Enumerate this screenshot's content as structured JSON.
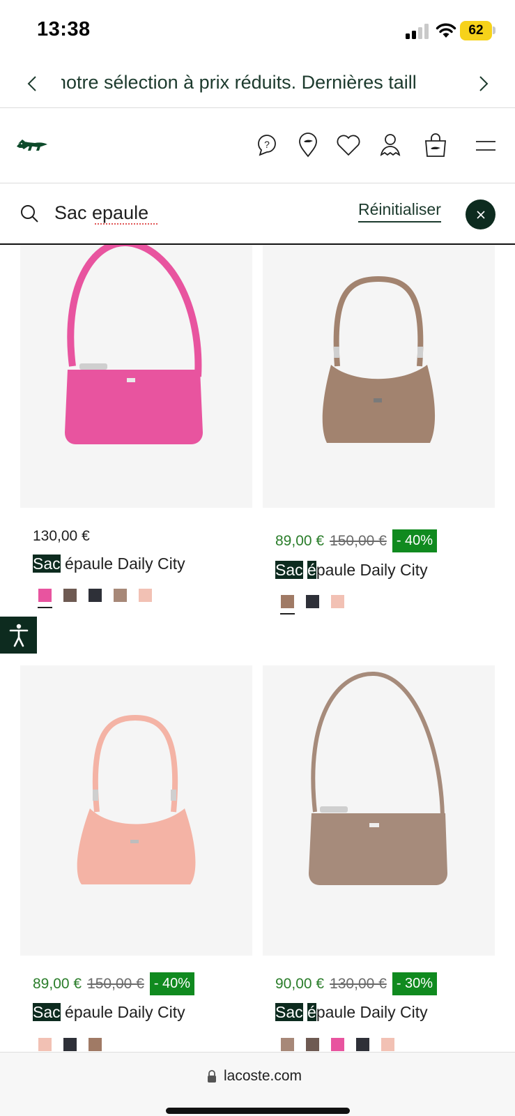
{
  "status_bar": {
    "time": "13:38",
    "battery": "62"
  },
  "promo": {
    "text": "notre sélection à prix réduits. Dernières taill"
  },
  "header": {
    "wishlist_count": "0",
    "cart_count": "0"
  },
  "search": {
    "query": "Sac epaule",
    "reset_label": "Réinitialiser"
  },
  "products": [
    {
      "price": "130,00 €",
      "title_highlight": "Sac",
      "title_rest": " épaule Daily City",
      "bag_color": "#e8549f",
      "swatches": [
        "#e8549f",
        "#6e5a52",
        "#2e3038",
        "#a78878",
        "#f2c1b4"
      ]
    },
    {
      "price": "89,00 €",
      "old_price": "150,00 €",
      "discount": "- 40%",
      "title_highlight": "Sac",
      "title_mid_highlight": "é",
      "title_rest": "paule Daily City",
      "bag_color": "#a2836f",
      "swatches": [
        "#a07a65",
        "#2e3038",
        "#f2c1b4"
      ]
    },
    {
      "price": "89,00 €",
      "old_price": "150,00 €",
      "discount": "- 40%",
      "title_highlight": "Sac",
      "title_rest": " épaule Daily City",
      "bag_color": "#f4b3a5",
      "swatches": [
        "#f2c1b4",
        "#2e3038",
        "#a07a65"
      ]
    },
    {
      "price": "90,00 €",
      "old_price": "130,00 €",
      "discount": "- 30%",
      "title_highlight": "Sac",
      "title_mid_highlight": "é",
      "title_rest": "paule Daily City",
      "bag_color": "#a68b7b",
      "swatches": [
        "#a78878",
        "#6e5a52",
        "#e8549f",
        "#2e3038",
        "#f2c1b4"
      ]
    }
  ],
  "url_bar": {
    "domain": "lacoste.com"
  }
}
